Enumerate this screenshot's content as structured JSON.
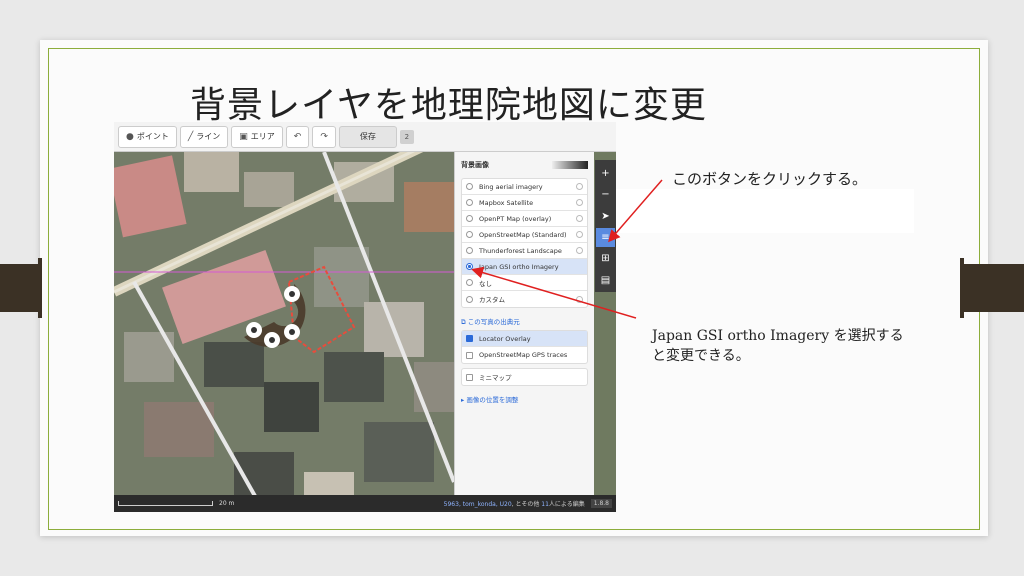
{
  "slide": {
    "title": "背景レイヤを地理院地図に変更"
  },
  "toolbar": {
    "point_label": "ポイント",
    "line_label": "ライン",
    "area_label": "エリア",
    "undo_icon": "undo-icon",
    "redo_icon": "redo-icon",
    "save_label": "保存",
    "edit_count": "2"
  },
  "background_panel": {
    "title": "背景画像",
    "layers": [
      {
        "label": "Bing aerial imagery",
        "selected": false
      },
      {
        "label": "Mapbox Satellite",
        "selected": false
      },
      {
        "label": "OpenPT Map (overlay)",
        "selected": false
      },
      {
        "label": "OpenStreetMap (Standard)",
        "selected": false
      },
      {
        "label": "Thunderforest Landscape",
        "selected": false
      },
      {
        "label": "Japan GSI ortho Imagery",
        "selected": true
      },
      {
        "label": "なし",
        "selected": false
      },
      {
        "label": "カスタム",
        "selected": false
      }
    ],
    "source_link": "この写真の出典元",
    "overlays": [
      {
        "label": "Locator Overlay",
        "checked": true
      },
      {
        "label": "OpenStreetMap GPS traces",
        "checked": false
      }
    ],
    "minimap_label": "ミニマップ",
    "offset_link": "画像の位置を調整"
  },
  "footer": {
    "scale": "20 m",
    "attribution_prefix": "5963, tom_konda, U20",
    "attribution_mid": ", とその他",
    "attribution_count": "11",
    "attribution_suffix": "人による編集",
    "version": "1.8.8"
  },
  "callouts": {
    "button_hint": "このボタンをクリックする。",
    "select_hint_1": "Japan GSI ortho Imagery を選択する",
    "select_hint_2": "と変更できる。"
  },
  "colors": {
    "accent": "#8cad3b",
    "tab": "#3b3125",
    "active_button": "#5a8be0",
    "arrow": "#e02020"
  }
}
